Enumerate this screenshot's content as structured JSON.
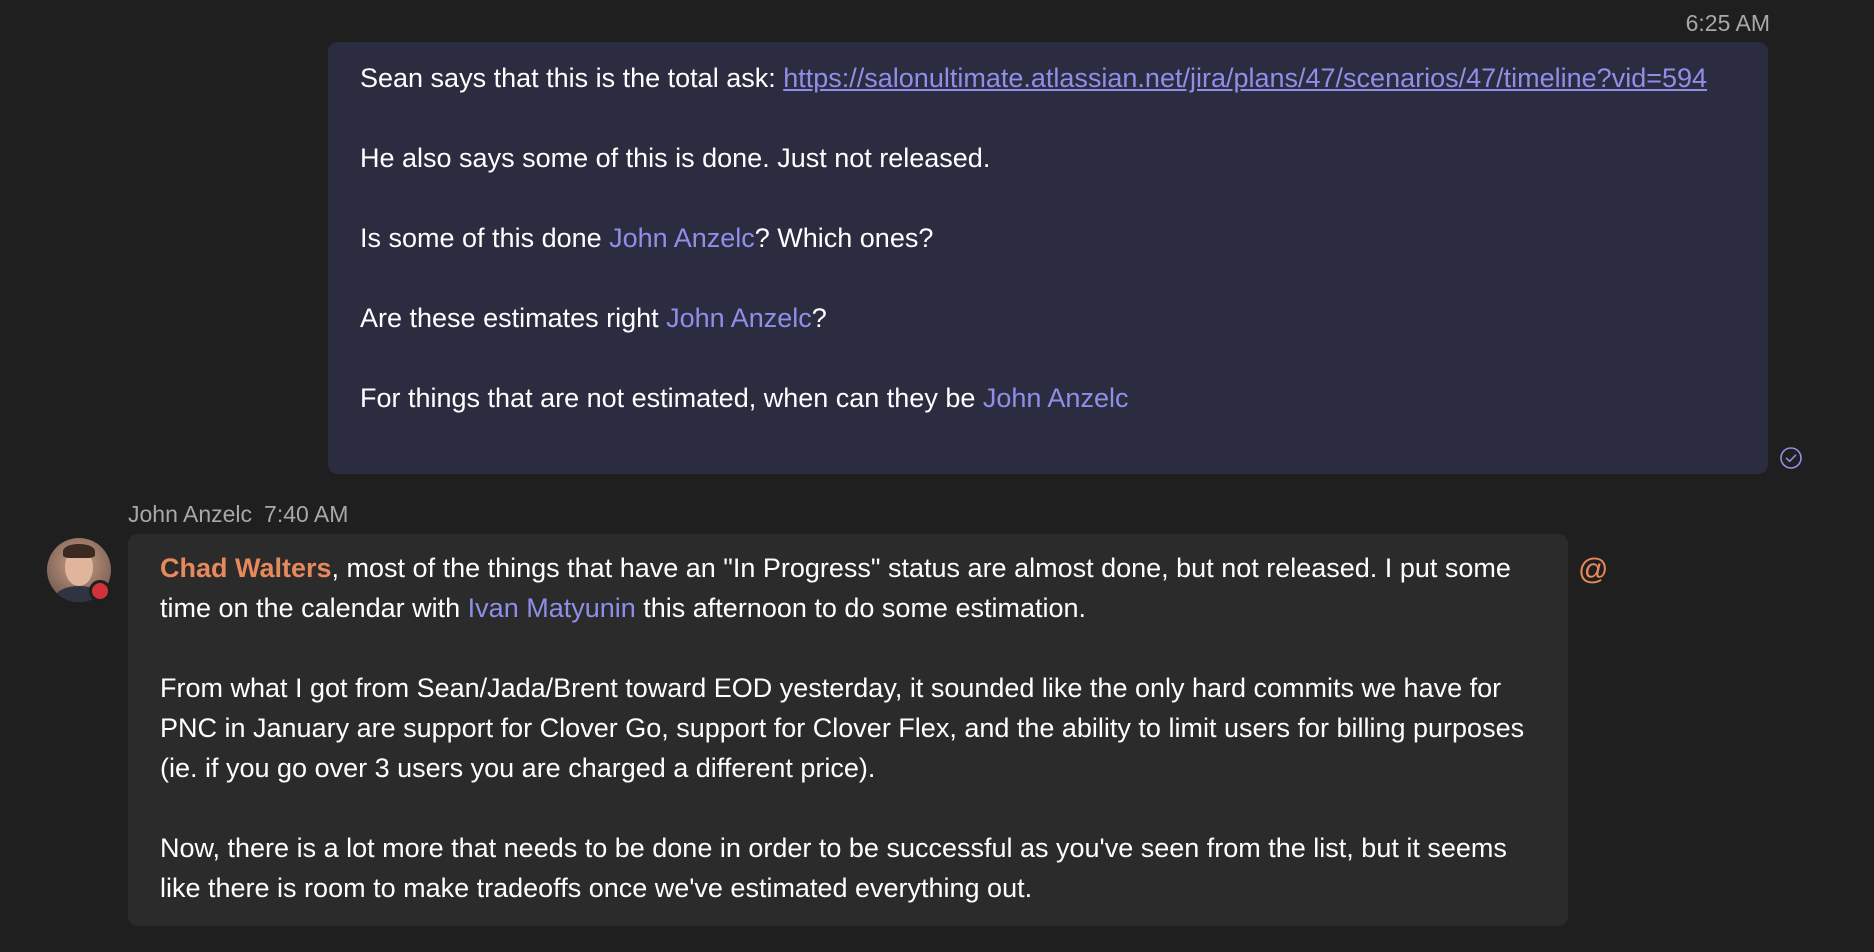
{
  "sent_message": {
    "time": "6:25 AM",
    "line1_text": "Sean says that this is the total ask: ",
    "line1_link": "https://salonultimate.atlassian.net/jira/plans/47/scenarios/47/timeline?vid=594",
    "line2_text": "He also says some of this is done. Just not released.",
    "line3_pre": "Is some of this done ",
    "line3_mention": "John Anzelc",
    "line3_post": "? Which ones?",
    "line4_pre": "Are these estimates right ",
    "line4_mention": "John Anzelc",
    "line4_post": "?",
    "line5_pre": "For things that are not estimated, when can they be ",
    "line5_mention": "John Anzelc",
    "read_receipt_icon": "read-receipt-icon"
  },
  "received_message": {
    "sender": "John Anzelc",
    "time": "7:40 AM",
    "p1_mention_me": "Chad Walters",
    "p1_text_a": ", most of the things that have an \"In Progress\" status are almost done, but not released. I put some time on the calendar with ",
    "p1_mention": "Ivan Matyunin",
    "p1_text_b": " this afternoon to do some estimation.",
    "p2_text": "From what I got from Sean/Jada/Brent toward EOD yesterday, it sounded like the only hard commits we have for PNC in January are support for Clover Go, support for Clover Flex, and the ability to limit users for billing purposes (ie. if you go over 3 users you are charged a different price).",
    "p3_text": "Now, there is a lot more that needs to be done in order to be successful as you've seen from the list, but it seems like there is room to make tradeoffs once we've estimated everything out.",
    "at_mention_icon": "@",
    "presence_status": "busy"
  },
  "colors": {
    "background": "#1f1f1f",
    "sent_bubble": "#2c2c40",
    "received_bubble": "#2b2b2b",
    "mention": "#8f8fea",
    "mention_me": "#e8895c",
    "presence_busy": "#d13438"
  }
}
